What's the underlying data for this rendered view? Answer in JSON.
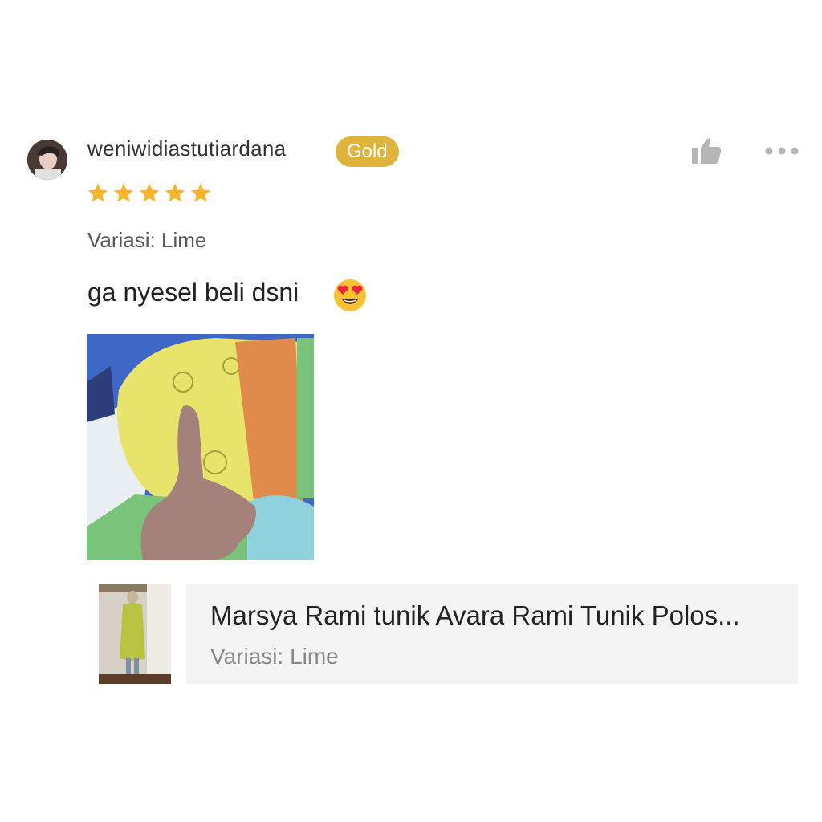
{
  "review": {
    "username": "weniwidiastutiardana",
    "badge": "Gold",
    "rating": 5,
    "variation": "Variasi: Lime",
    "text": "ga nyesel beli dsni"
  },
  "icons": {
    "like": "thumbs-up-icon",
    "more": "more-dots-icon",
    "star": "star-icon",
    "emoji": "heart-eyes-emoji"
  },
  "product": {
    "name": "Marsya Rami tunik Avara Rami Tunik Polos...",
    "variation": "Variasi: Lime"
  },
  "colors": {
    "badge": "#e0b43a",
    "star": "#f7b52c",
    "card_bg": "#f4f4f4",
    "icon_gray": "#b5b5b5"
  }
}
